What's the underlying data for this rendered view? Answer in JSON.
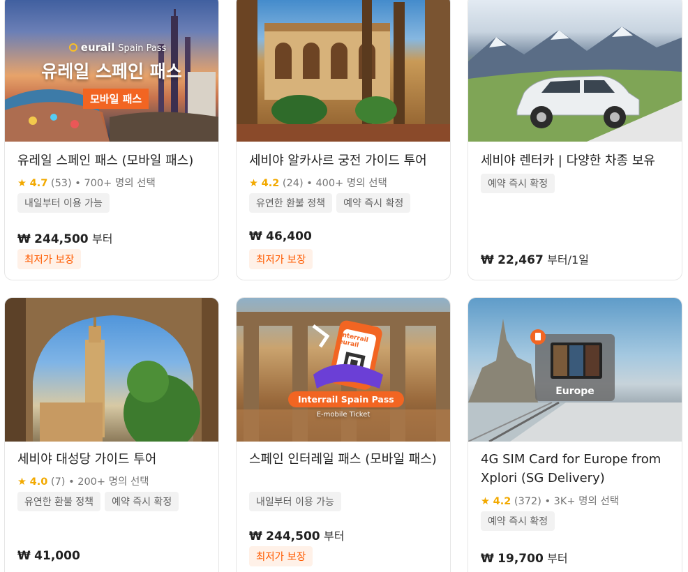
{
  "cards": [
    {
      "image_brand": "eurail",
      "image_brand_sub": "Spain Pass",
      "image_headline": "유레일 스페인 패스",
      "image_badge": "모바일 패스",
      "title": "유레일 스페인 패스 (모바일 패스)",
      "rating": "4.7",
      "reviews": "(53)",
      "booked": "• 700+ 명의 선택",
      "tags": [
        "내일부터 이용 가능"
      ],
      "price_currency": "₩",
      "price": "244,500",
      "price_suffix": "부터",
      "badge": "최저가 보장"
    },
    {
      "title": "세비야 알카사르 궁전 가이드 투어",
      "rating": "4.2",
      "reviews": "(24)",
      "booked": "• 400+ 명의 선택",
      "tags": [
        "유연한 환불 정책",
        "예약 즉시 확정"
      ],
      "price_currency": "₩",
      "price": "46,400",
      "price_suffix": "",
      "badge": "최저가 보장"
    },
    {
      "title": "세비야 렌터카 | 다양한 차종 보유",
      "tags": [
        "예약 즉시 확정"
      ],
      "price_currency": "₩",
      "price": "22,467",
      "price_suffix": "부터/1일"
    },
    {
      "title": "세비야 대성당 가이드 투어",
      "rating": "4.0",
      "reviews": "(7)",
      "booked": "• 200+ 명의 선택",
      "tags": [
        "유연한 환불 정책",
        "예약 즉시 확정"
      ],
      "price_currency": "₩",
      "price": "41,000",
      "price_suffix": ""
    },
    {
      "image_ticket_brand1": "interrail",
      "image_ticket_brand2": "eurail",
      "image_headline": "Interrail Spain Pass",
      "image_sub": "E-mobile Ticket",
      "title": "스페인 인터레일 패스 (모바일 패스)",
      "tags": [
        "내일부터 이용 가능"
      ],
      "price_currency": "₩",
      "price": "244,500",
      "price_suffix": "부터",
      "badge": "최저가 보장"
    },
    {
      "image_label": "Europe",
      "title": "4G SIM Card for Europe from Xplori (SG Delivery)",
      "rating": "4.2",
      "reviews": "(372)",
      "booked": "• 3K+ 명의 선택",
      "tags": [
        "예약 즉시 확정"
      ],
      "price_currency": "₩",
      "price": "19,700",
      "price_suffix": "부터"
    }
  ],
  "icons": {
    "star": "star-icon"
  },
  "colors": {
    "accent": "#ff5b00",
    "star": "#f2a900",
    "badge_bg": "#fff1e8",
    "tag_bg": "#f2f2f2"
  }
}
